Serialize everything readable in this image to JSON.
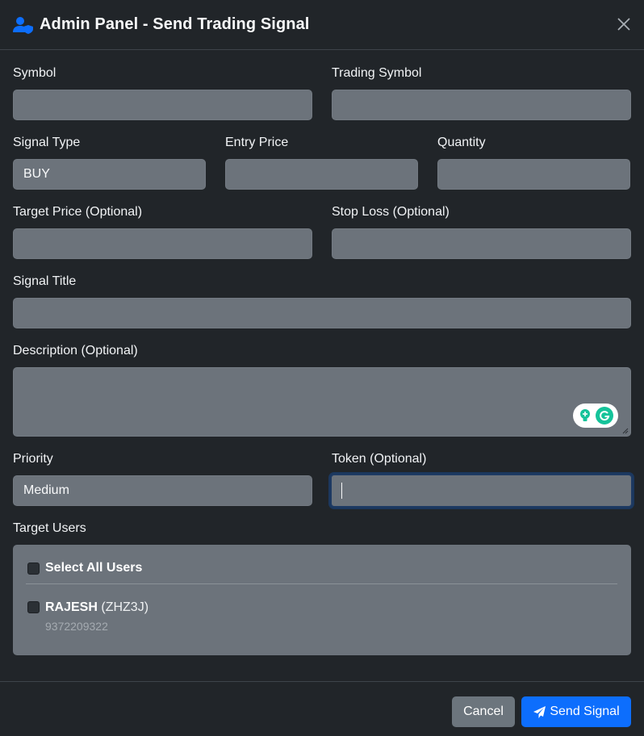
{
  "header": {
    "title": "Admin Panel - Send Trading Signal",
    "icon": "user-shield-icon",
    "close_icon": "close-icon"
  },
  "form": {
    "symbol": {
      "label": "Symbol",
      "value": ""
    },
    "trading_symbol": {
      "label": "Trading Symbol",
      "value": ""
    },
    "signal_type": {
      "label": "Signal Type",
      "value": "BUY"
    },
    "entry_price": {
      "label": "Entry Price",
      "value": ""
    },
    "quantity": {
      "label": "Quantity",
      "value": ""
    },
    "target_price": {
      "label": "Target Price (Optional)",
      "value": ""
    },
    "stop_loss": {
      "label": "Stop Loss (Optional)",
      "value": ""
    },
    "signal_title": {
      "label": "Signal Title",
      "value": ""
    },
    "description": {
      "label": "Description (Optional)",
      "value": ""
    },
    "priority": {
      "label": "Priority",
      "value": "Medium"
    },
    "token": {
      "label": "Token (Optional)",
      "value": ""
    }
  },
  "target_users": {
    "label": "Target Users",
    "select_all_label": "Select All Users",
    "users": [
      {
        "name": "RAJESH",
        "code": "(ZHZ3J)",
        "phone": "9372209322",
        "checked": false
      }
    ]
  },
  "footer": {
    "cancel_label": "Cancel",
    "send_label": "Send Signal",
    "send_icon": "paper-plane-icon"
  },
  "colors": {
    "background": "#212529",
    "field": "#6c737b",
    "primary": "#0d6efd",
    "secondary": "#6c757d"
  }
}
